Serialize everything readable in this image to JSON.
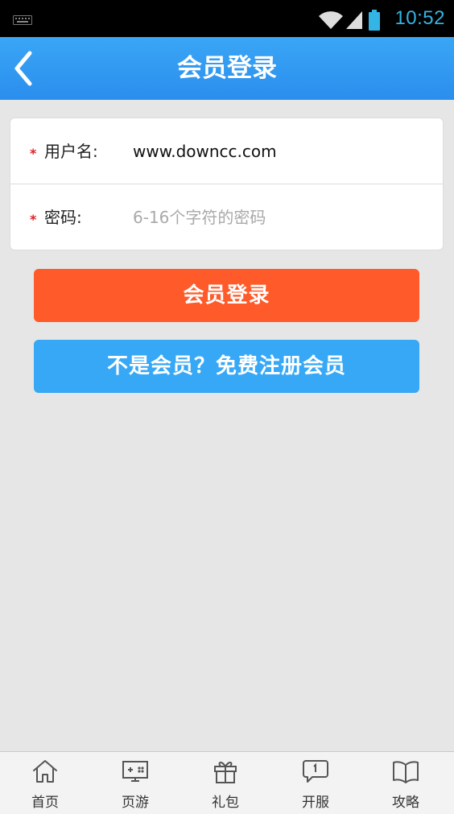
{
  "status_bar": {
    "time": "10:52",
    "icons": [
      "keyboard-icon",
      "wifi-icon",
      "signal-icon",
      "battery-icon"
    ]
  },
  "header": {
    "title": "会员登录",
    "back_icon": "chevron-left-icon"
  },
  "form": {
    "username": {
      "required_mark": "*",
      "label": "用户名:",
      "value": "www.downcc.com",
      "placeholder": ""
    },
    "password": {
      "required_mark": "*",
      "label": "密码:",
      "value": "",
      "placeholder": "6-16个字符的密码"
    }
  },
  "buttons": {
    "login": "会员登录",
    "register": "不是会员？免费注册会员"
  },
  "bottom_nav": [
    {
      "label": "首页",
      "icon": "home-icon"
    },
    {
      "label": "页游",
      "icon": "game-console-icon"
    },
    {
      "label": "礼包",
      "icon": "gift-icon"
    },
    {
      "label": "开服",
      "icon": "speech-bubble-icon"
    },
    {
      "label": "攻略",
      "icon": "book-icon"
    }
  ],
  "colors": {
    "header": "#2a8eed",
    "login_button": "#ff5a29",
    "register_button": "#37a8f5",
    "status_accent": "#33b5e5",
    "required_star": "#e02020",
    "background": "#e6e6e6"
  }
}
